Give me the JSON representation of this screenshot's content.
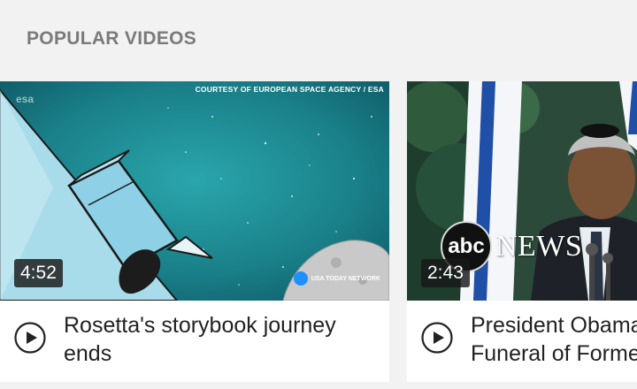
{
  "section": {
    "title": "POPULAR VIDEOS"
  },
  "videos": [
    {
      "title": "Rosetta's storybook journey ends",
      "duration": "4:52",
      "thumbnail_credit": "COURTESY OF EUROPEAN SPACE AGENCY / ESA",
      "thumbnail_logo_top": "esa",
      "thumbnail_logo_bottom": "USA TODAY NETWORK",
      "icon": "play-circle-icon"
    },
    {
      "title": "President Obama Funeral of Former",
      "title_lines": [
        "President Obama",
        "Funeral of Forme"
      ],
      "duration": "2:43",
      "thumbnail_logo_circle": "abc",
      "thumbnail_logo_word": "NEWS",
      "icon": "play-circle-icon"
    }
  ],
  "colors": {
    "background": "#f2f2f2",
    "section_title": "#7a7a7a",
    "card": "#ffffff",
    "space_teal": "#1b8a92",
    "usa_today_blue": "#1e90ff"
  }
}
